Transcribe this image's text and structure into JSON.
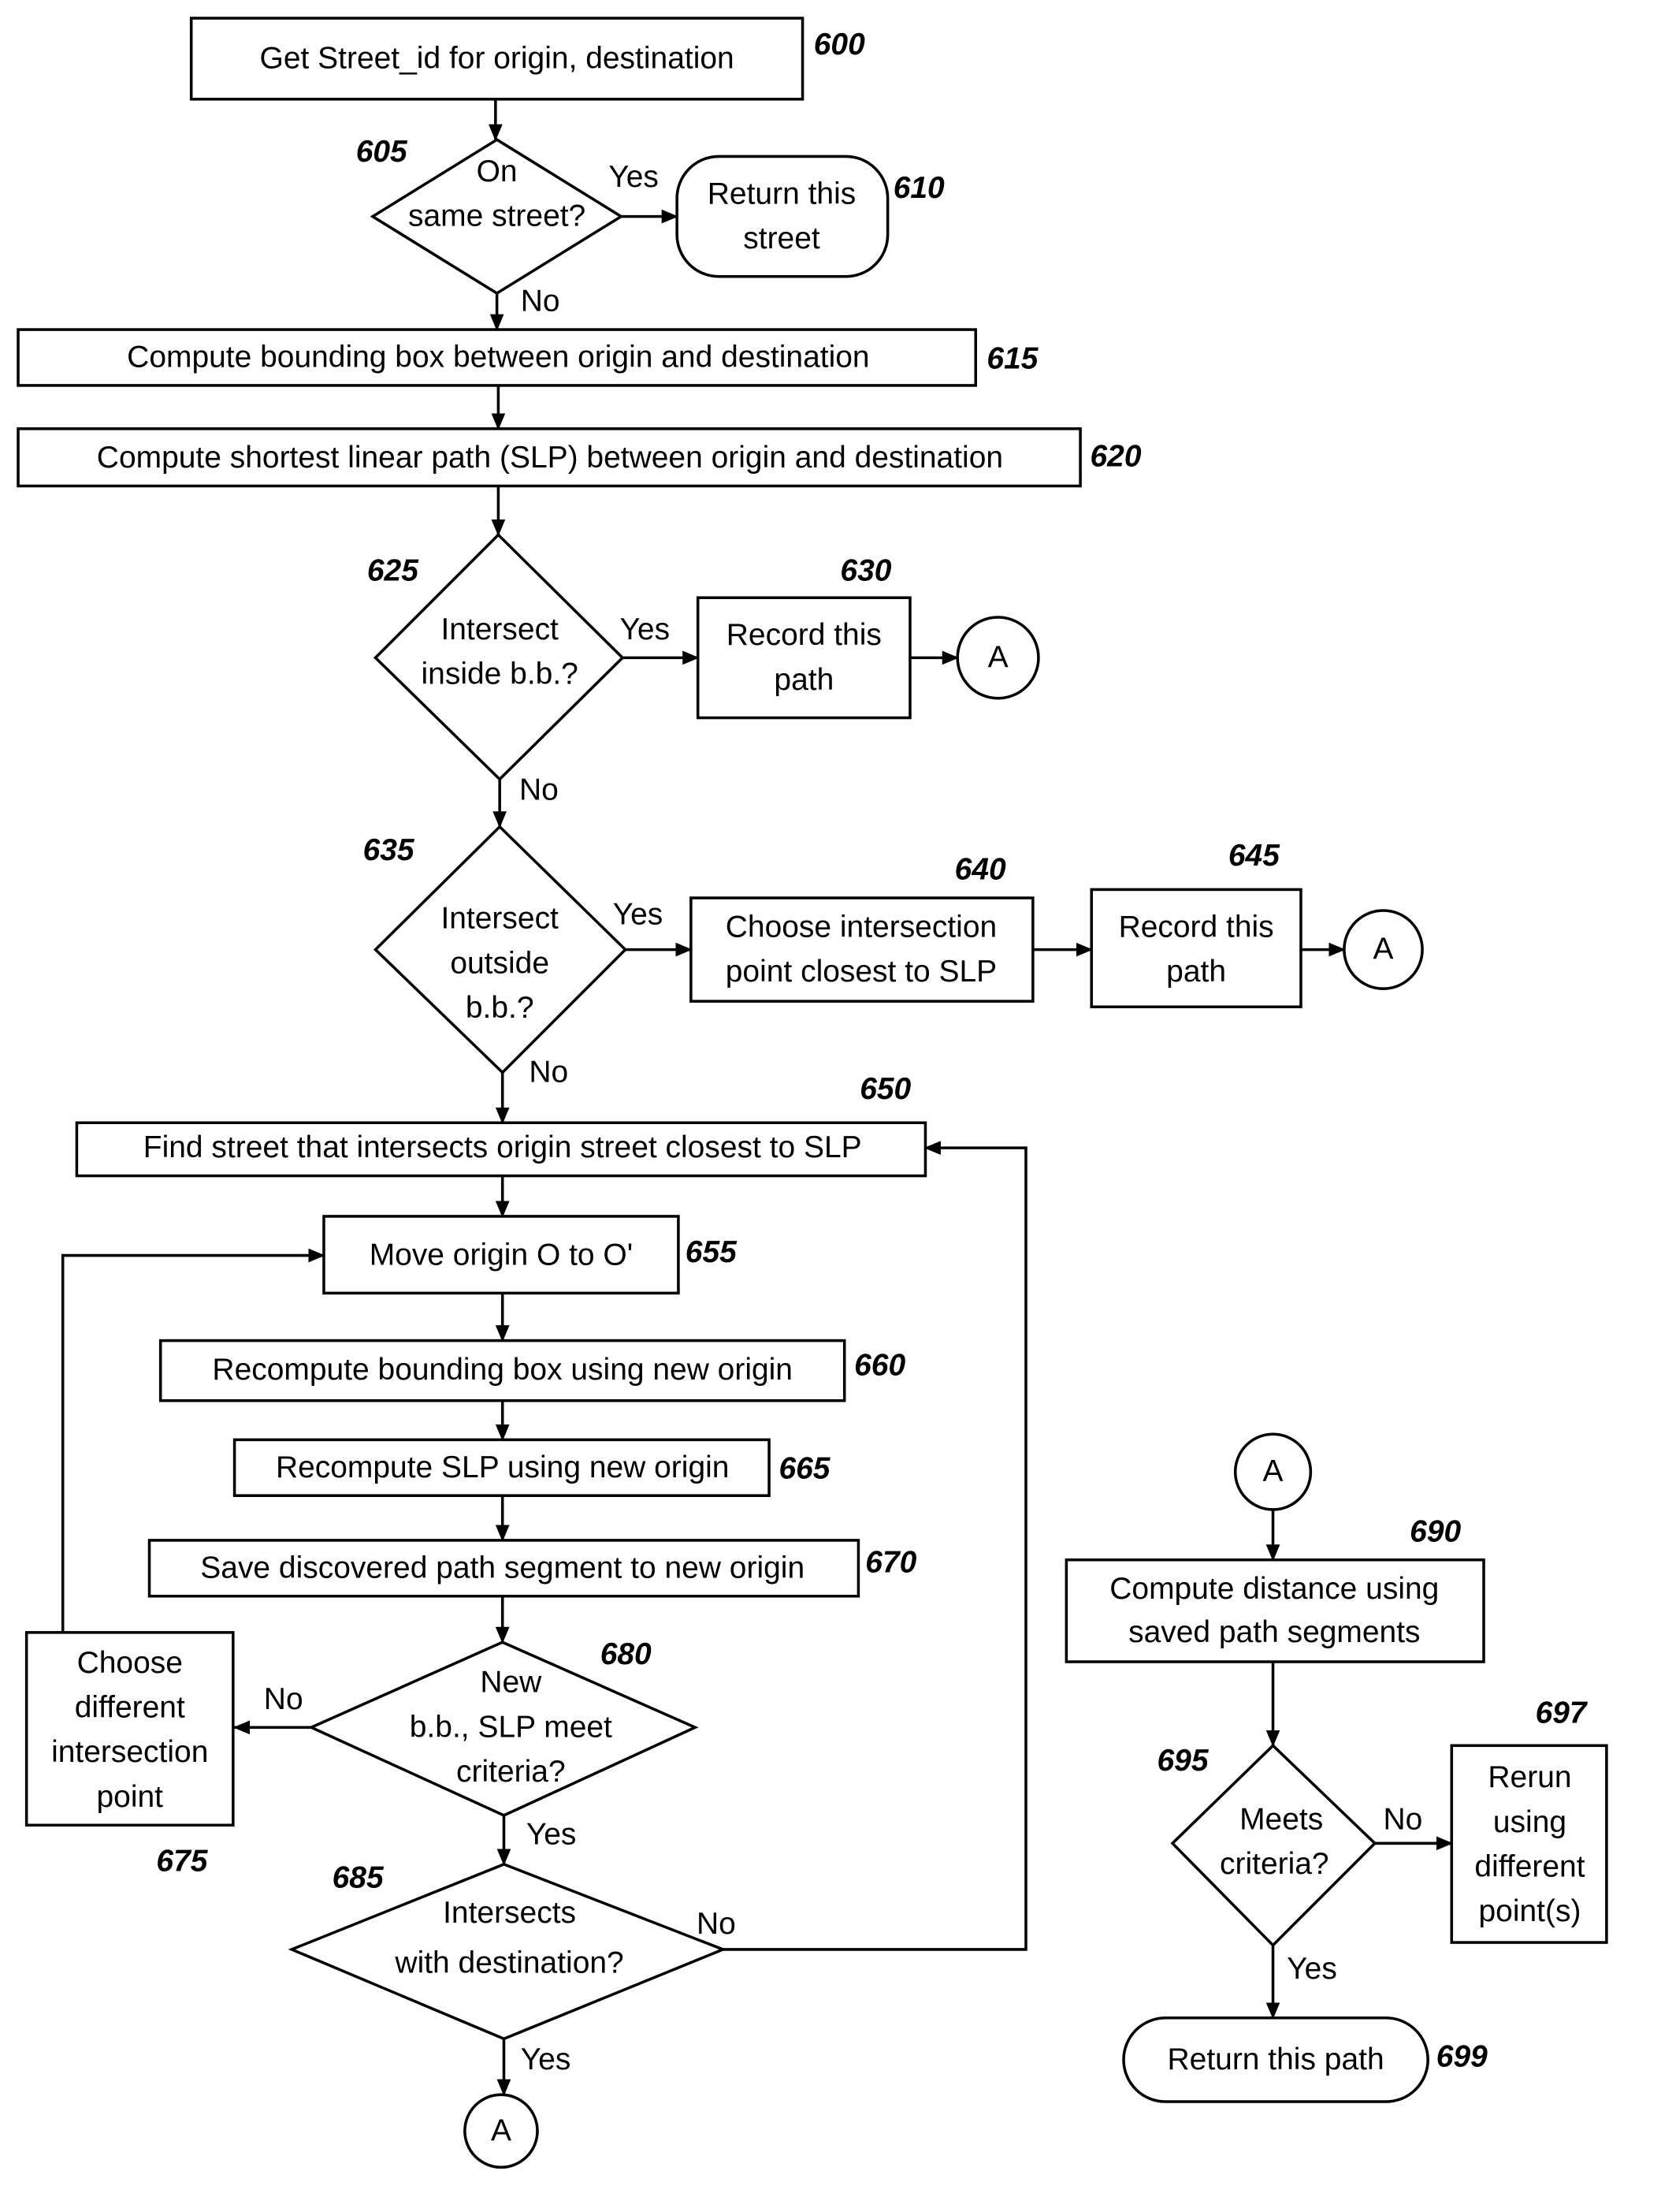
{
  "diagram": {
    "type": "flowchart",
    "nodes": {
      "n600": {
        "ref": "600",
        "kind": "process",
        "lines": [
          "Get Street_id for origin, destination"
        ]
      },
      "n605": {
        "ref": "605",
        "kind": "decision",
        "lines": [
          "On",
          "same street?"
        ]
      },
      "n610": {
        "ref": "610",
        "kind": "terminal",
        "lines": [
          "Return this",
          "street"
        ]
      },
      "n615": {
        "ref": "615",
        "kind": "process",
        "lines": [
          "Compute bounding box between origin and destination"
        ]
      },
      "n620": {
        "ref": "620",
        "kind": "process",
        "lines": [
          "Compute shortest linear path (SLP) between origin and destination"
        ]
      },
      "n625": {
        "ref": "625",
        "kind": "decision",
        "lines": [
          "Intersect",
          "inside b.b.?"
        ]
      },
      "n630": {
        "ref": "630",
        "kind": "process",
        "lines": [
          "Record this",
          "path"
        ]
      },
      "n635": {
        "ref": "635",
        "kind": "decision",
        "lines": [
          "Intersect",
          "outside",
          "b.b.?"
        ]
      },
      "n640": {
        "ref": "640",
        "kind": "process",
        "lines": [
          "Choose intersection",
          "point closest to SLP"
        ]
      },
      "n645": {
        "ref": "645",
        "kind": "process",
        "lines": [
          "Record this",
          "path"
        ]
      },
      "n650": {
        "ref": "650",
        "kind": "process",
        "lines": [
          "Find street that intersects origin street closest to SLP"
        ]
      },
      "n655": {
        "ref": "655",
        "kind": "process",
        "lines": [
          "Move origin O to O'"
        ]
      },
      "n660": {
        "ref": "660",
        "kind": "process",
        "lines": [
          "Recompute bounding box using new origin"
        ]
      },
      "n665": {
        "ref": "665",
        "kind": "process",
        "lines": [
          "Recompute SLP using new origin"
        ]
      },
      "n670": {
        "ref": "670",
        "kind": "process",
        "lines": [
          "Save discovered path segment to new origin"
        ]
      },
      "n675": {
        "ref": "675",
        "kind": "process",
        "lines": [
          "Choose",
          "different",
          "intersection",
          "point"
        ]
      },
      "n680": {
        "ref": "680",
        "kind": "decision",
        "lines": [
          "New",
          "b.b., SLP meet",
          "criteria?"
        ]
      },
      "n685": {
        "ref": "685",
        "kind": "decision",
        "lines": [
          "Intersects",
          "with destination?"
        ]
      },
      "n690": {
        "ref": "690",
        "kind": "process",
        "lines": [
          "Compute distance using",
          "saved path segments"
        ]
      },
      "n695": {
        "ref": "695",
        "kind": "decision",
        "lines": [
          "Meets",
          "criteria?"
        ]
      },
      "n697": {
        "ref": "697",
        "kind": "process",
        "lines": [
          "Rerun",
          "using",
          "different",
          "point(s)"
        ]
      },
      "n699": {
        "ref": "699",
        "kind": "terminal",
        "lines": [
          "Return this path"
        ]
      }
    },
    "connector_label": "A",
    "edge_labels": {
      "yes": "Yes",
      "no": "No"
    }
  }
}
